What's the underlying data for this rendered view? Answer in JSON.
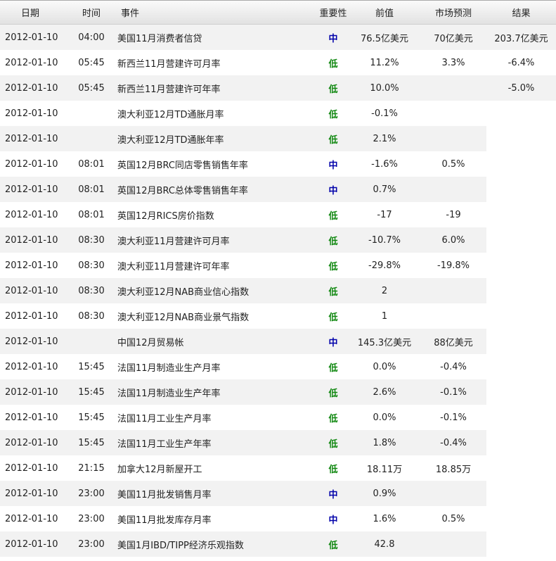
{
  "headers": {
    "date": "日期",
    "time": "时间",
    "event": "事件",
    "importance": "重要性",
    "previous": "前值",
    "forecast": "市场预测",
    "result": "结果"
  },
  "colors": {
    "importance_mid": "#0000aa",
    "importance_low": "#118811"
  },
  "rows": [
    {
      "date": "2012-01-10",
      "time": "04:00",
      "event": "美国11月消费者信贷",
      "importance": "中",
      "previous": "76.5亿美元",
      "forecast": "70亿美元",
      "result": "203.7亿美元"
    },
    {
      "date": "2012-01-10",
      "time": "05:45",
      "event": "新西兰11月营建许可月率",
      "importance": "低",
      "previous": "11.2%",
      "forecast": "3.3%",
      "result": "-6.4%"
    },
    {
      "date": "2012-01-10",
      "time": "05:45",
      "event": "新西兰11月营建许可年率",
      "importance": "低",
      "previous": "10.0%",
      "forecast": "",
      "result": "-5.0%"
    },
    {
      "date": "2012-01-10",
      "time": "",
      "event": "澳大利亚12月TD通胀月率",
      "importance": "低",
      "previous": "-0.1%",
      "forecast": "",
      "result": ""
    },
    {
      "date": "2012-01-10",
      "time": "",
      "event": "澳大利亚12月TD通胀年率",
      "importance": "低",
      "previous": "2.1%",
      "forecast": "",
      "result": ""
    },
    {
      "date": "2012-01-10",
      "time": "08:01",
      "event": "英国12月BRC同店零售销售年率",
      "importance": "中",
      "previous": "-1.6%",
      "forecast": "0.5%",
      "result": ""
    },
    {
      "date": "2012-01-10",
      "time": "08:01",
      "event": "英国12月BRC总体零售销售年率",
      "importance": "中",
      "previous": "0.7%",
      "forecast": "",
      "result": ""
    },
    {
      "date": "2012-01-10",
      "time": "08:01",
      "event": "英国12月RICS房价指数",
      "importance": "低",
      "previous": "-17",
      "forecast": "-19",
      "result": ""
    },
    {
      "date": "2012-01-10",
      "time": "08:30",
      "event": "澳大利亚11月营建许可月率",
      "importance": "低",
      "previous": "-10.7%",
      "forecast": "6.0%",
      "result": ""
    },
    {
      "date": "2012-01-10",
      "time": "08:30",
      "event": "澳大利亚11月营建许可年率",
      "importance": "低",
      "previous": "-29.8%",
      "forecast": "-19.8%",
      "result": ""
    },
    {
      "date": "2012-01-10",
      "time": "08:30",
      "event": "澳大利亚12月NAB商业信心指数",
      "importance": "低",
      "previous": "2",
      "forecast": "",
      "result": ""
    },
    {
      "date": "2012-01-10",
      "time": "08:30",
      "event": "澳大利亚12月NAB商业景气指数",
      "importance": "低",
      "previous": "1",
      "forecast": "",
      "result": ""
    },
    {
      "date": "2012-01-10",
      "time": "",
      "event": "中国12月贸易帐",
      "importance": "中",
      "previous": "145.3亿美元",
      "forecast": "88亿美元",
      "result": ""
    },
    {
      "date": "2012-01-10",
      "time": "15:45",
      "event": "法国11月制造业生产月率",
      "importance": "低",
      "previous": "0.0%",
      "forecast": "-0.4%",
      "result": ""
    },
    {
      "date": "2012-01-10",
      "time": "15:45",
      "event": "法国11月制造业生产年率",
      "importance": "低",
      "previous": "2.6%",
      "forecast": "-0.1%",
      "result": ""
    },
    {
      "date": "2012-01-10",
      "time": "15:45",
      "event": "法国11月工业生产月率",
      "importance": "低",
      "previous": "0.0%",
      "forecast": "-0.1%",
      "result": ""
    },
    {
      "date": "2012-01-10",
      "time": "15:45",
      "event": "法国11月工业生产年率",
      "importance": "低",
      "previous": "1.8%",
      "forecast": "-0.4%",
      "result": ""
    },
    {
      "date": "2012-01-10",
      "time": "21:15",
      "event": "加拿大12月新屋开工",
      "importance": "低",
      "previous": "18.11万",
      "forecast": "18.85万",
      "result": ""
    },
    {
      "date": "2012-01-10",
      "time": "23:00",
      "event": "美国11月批发销售月率",
      "importance": "中",
      "previous": "0.9%",
      "forecast": "",
      "result": ""
    },
    {
      "date": "2012-01-10",
      "time": "23:00",
      "event": "美国11月批发库存月率",
      "importance": "中",
      "previous": "1.6%",
      "forecast": "0.5%",
      "result": ""
    },
    {
      "date": "2012-01-10",
      "time": "23:00",
      "event": "美国1月IBD/TIPP经济乐观指数",
      "importance": "低",
      "previous": "42.8",
      "forecast": "",
      "result": ""
    }
  ]
}
